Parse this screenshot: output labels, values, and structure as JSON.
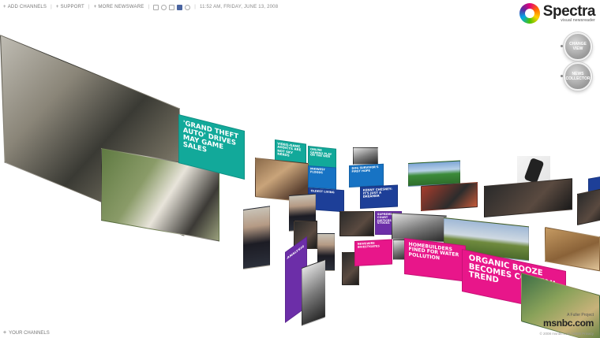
{
  "topbar": {
    "add_channels": "ADD CHANNELS",
    "support": "SUPPORT",
    "more_newsware": "MORE NEWSWARE",
    "datetime": "11:52 AM, FRIDAY, JUNE 13, 2008"
  },
  "logo": {
    "title": "Spectra",
    "beta": "beta",
    "subtitle": "visual newsreader"
  },
  "buttons": {
    "change_view": "CHANGE VIEW",
    "news_collector": "NEWS COLLECTOR"
  },
  "headlines": {
    "gta": "'GRAND THEFT AUTO' DRIVES MAY GAME SALES",
    "video_game": "VIDEO-GAME ADDICTS ARE NOT SKY NERDS",
    "online_gaming": "ONLINE GAMING PLAY ON THE WEB",
    "floods": "MIDWEST FLOODS",
    "dog_survivor": "DOG SURVIVOR'S FIRST HOPE",
    "sports": "TERRIBLE TOWEL",
    "oldest": "OLDEST LIVING",
    "kenny": "KENNY CHESNEY: IT'S JUST A DREAMER",
    "justices": "SUPREME COURT JUSTICES STOCKS",
    "newswire": "NEWSWIRE INVESTIGATES",
    "homebuilders": "HOMEBUILDERS FINED FOR WATER POLLUTION",
    "organic": "ORGANIC BOOZE BECOMES COCKTAIL TREND",
    "purple_tile": "ANALYSIS"
  },
  "footer": {
    "your_channels": "YOUR CHANNELS",
    "fuller": "A Fuller Project",
    "msnbc": "msnbc.com",
    "copyright": "© 2008 msnbc.com  |  MSN Privacy"
  },
  "colors": {
    "teal": "#12a99a",
    "blue": "#1773c4",
    "navy": "#1d3f98",
    "pink": "#e8168a",
    "purple": "#6c2ea8"
  }
}
